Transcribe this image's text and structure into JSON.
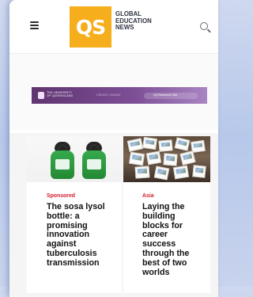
{
  "header": {
    "logo_text": "QS",
    "brand_text": "GLOBAL\nEDUCATION\nNEWS",
    "icons": {
      "menu": "menu-icon",
      "search": "search-icon"
    }
  },
  "ad_banner": {
    "brand_text": "THE UNIVERSITY\nOF QUEENSLAND",
    "tagline": "CREATE CHANGE",
    "cta_text": "UQ Research Hub"
  },
  "articles": [
    {
      "category": "Sponsored",
      "headline": "The sosa lysol bottle: a promising innovation against tuberculosis transmission"
    },
    {
      "category": "Asia",
      "headline": "Laying the building blocks for career success through the best of two worlds"
    }
  ],
  "colors": {
    "logo_bg": "#f6ae1d",
    "sponsored_text": "#d01c2a",
    "banner_purple": "#6b3e7f"
  }
}
